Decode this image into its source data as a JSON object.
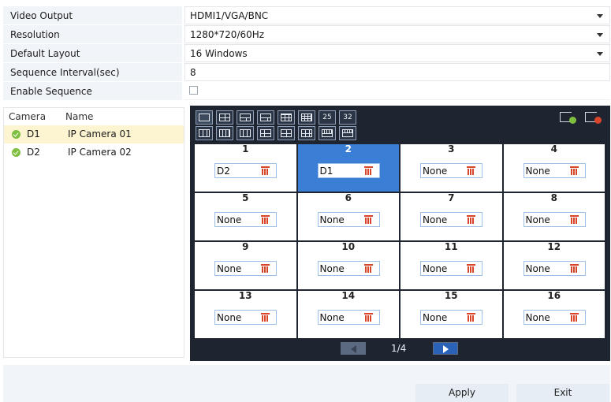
{
  "form": {
    "video_output": {
      "label": "Video Output",
      "value": "HDMI1/VGA/BNC"
    },
    "resolution": {
      "label": "Resolution",
      "value": "1280*720/60Hz"
    },
    "default_layout": {
      "label": "Default Layout",
      "value": "16 Windows"
    },
    "sequence_interval": {
      "label": "Sequence Interval(sec)",
      "value": "8"
    },
    "enable_sequence": {
      "label": "Enable Sequence",
      "checked": false
    }
  },
  "camera_list": {
    "headers": {
      "camera": "Camera",
      "name": "Name"
    },
    "rows": [
      {
        "id": "D1",
        "name": "IP Camera 01",
        "status": "online",
        "selected": true
      },
      {
        "id": "D2",
        "name": "IP Camera 02",
        "status": "online",
        "selected": false
      }
    ]
  },
  "layout_buttons": {
    "row1": [
      "layout-1-icon",
      "layout-4-icon",
      "layout-6-icon",
      "layout-8-icon",
      "layout-9-icon",
      "layout-16-icon",
      "25",
      "32"
    ],
    "row2": [
      "layout-3-icon",
      "layout-4v-icon",
      "layout-5-icon",
      "layout-7-icon",
      "layout-10-icon",
      "layout-12-icon",
      "layout-13-icon",
      "layout-14-icon"
    ]
  },
  "grid": {
    "cells": [
      {
        "num": "1",
        "value": "D2",
        "selected": false
      },
      {
        "num": "2",
        "value": "D1",
        "selected": true
      },
      {
        "num": "3",
        "value": "None",
        "selected": false
      },
      {
        "num": "4",
        "value": "None",
        "selected": false
      },
      {
        "num": "5",
        "value": "None",
        "selected": false
      },
      {
        "num": "6",
        "value": "None",
        "selected": false
      },
      {
        "num": "7",
        "value": "None",
        "selected": false
      },
      {
        "num": "8",
        "value": "None",
        "selected": false
      },
      {
        "num": "9",
        "value": "None",
        "selected": false
      },
      {
        "num": "10",
        "value": "None",
        "selected": false
      },
      {
        "num": "11",
        "value": "None",
        "selected": false
      },
      {
        "num": "12",
        "value": "None",
        "selected": false
      },
      {
        "num": "13",
        "value": "None",
        "selected": false
      },
      {
        "num": "14",
        "value": "None",
        "selected": false
      },
      {
        "num": "15",
        "value": "None",
        "selected": false
      },
      {
        "num": "16",
        "value": "None",
        "selected": false
      }
    ]
  },
  "pager": {
    "text": "1/4"
  },
  "colors": {
    "accent": "#3a7fd5",
    "delete": "#d9452a",
    "online": "#7fbf3f",
    "panel": "#1e2430"
  },
  "footer": {
    "apply": "Apply",
    "exit": "Exit"
  }
}
